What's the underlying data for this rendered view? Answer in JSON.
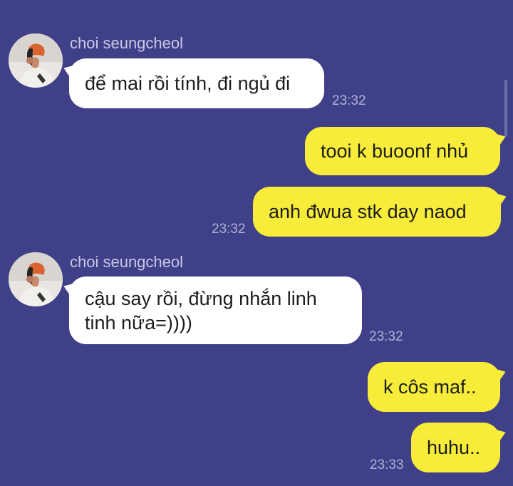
{
  "theme": {
    "background": "#3f4088",
    "incoming_bubble": "#ffffff",
    "outgoing_bubble": "#f7ec39",
    "sender_name_color": "#c7c8e6",
    "timestamp_color": "#aeb0d6"
  },
  "messages": [
    {
      "direction": "incoming",
      "sender": "choi seungcheol",
      "avatar": "profile-photo",
      "text": "để mai rồi tính, đi ngủ đi",
      "time": "23:32"
    },
    {
      "direction": "outgoing",
      "text": "tooi k buoonf nhủ",
      "time": ""
    },
    {
      "direction": "outgoing",
      "text": "anh đwua stk day naod",
      "time": "23:32"
    },
    {
      "direction": "incoming",
      "sender": "choi seungcheol",
      "avatar": "profile-photo",
      "text_lines": [
        "cậu say rồi, đừng nhắn linh",
        "tinh nữa=))))"
      ],
      "time": "23:32"
    },
    {
      "direction": "outgoing",
      "text": "k côs maf..",
      "time": ""
    },
    {
      "direction": "outgoing",
      "text": "huhu..",
      "time": "23:33"
    }
  ]
}
